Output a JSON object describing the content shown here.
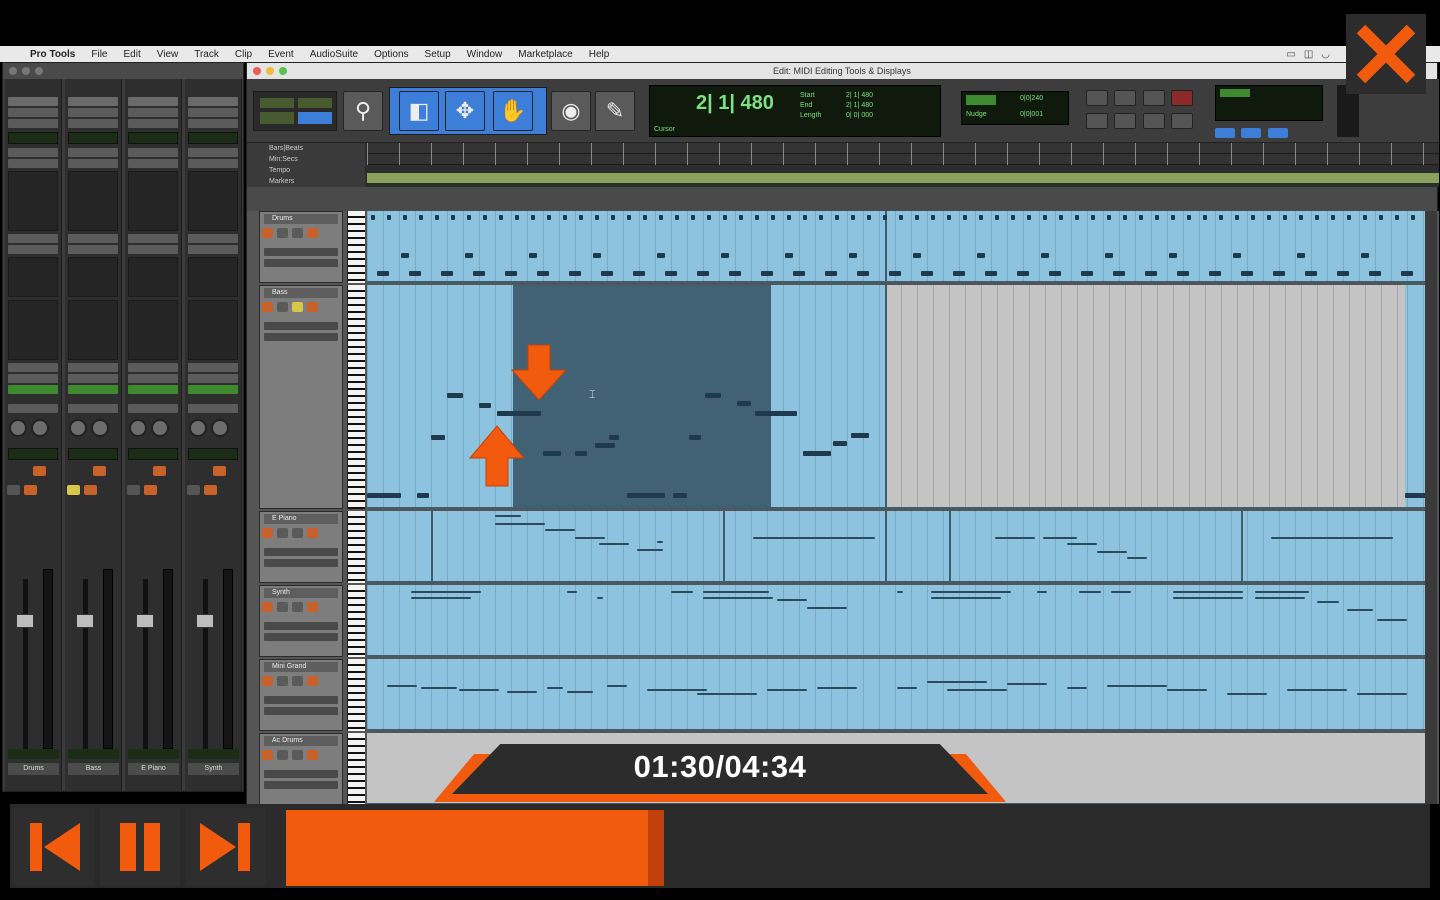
{
  "menubar": {
    "app": "Pro Tools",
    "items": [
      "File",
      "Edit",
      "View",
      "Track",
      "Clip",
      "Event",
      "AudioSuite",
      "Options",
      "Setup",
      "Window",
      "Marketplace",
      "Help"
    ]
  },
  "edit_window": {
    "title": "Edit: MIDI Editing Tools & Displays",
    "counter": "2| 1| 480",
    "counter_labels": [
      "Start",
      "End",
      "Length"
    ],
    "start_value": "2| 1| 480",
    "end_value": "2| 1| 480",
    "length_value": "0| 0| 000",
    "cursor_label": "Cursor",
    "grid_value": "0|0|240",
    "nudge_label": "Nudge",
    "nudge_value": "0|0|001"
  },
  "rulers": [
    "Bars|Beats",
    "Min:Secs",
    "Tempo",
    "Markers"
  ],
  "tracks": [
    "Drums",
    "Bass",
    "E Piano",
    "Synth",
    "Mini Grand",
    "Ac Drums"
  ],
  "mixer": {
    "strip_names": [
      "Drums",
      "Bass",
      "E Piano",
      "Synth"
    ]
  },
  "player": {
    "time": "01:30/04:34",
    "progress": 0.331,
    "accent": "#f25b0e"
  }
}
